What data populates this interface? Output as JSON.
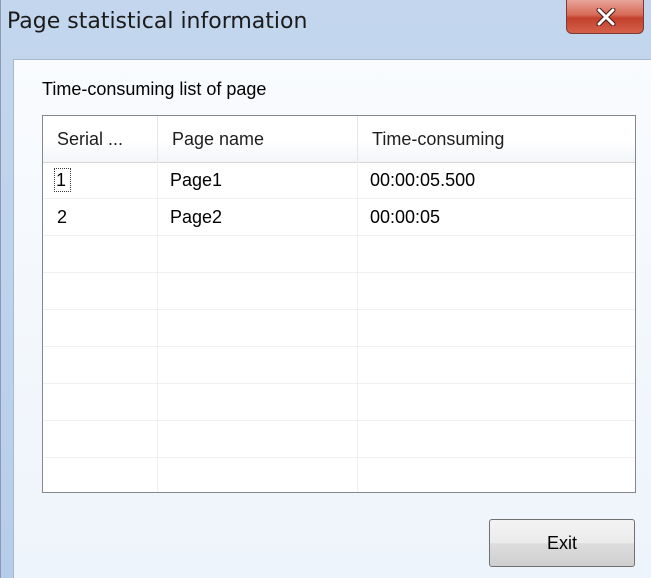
{
  "window": {
    "title": "Page statistical information"
  },
  "list": {
    "label": "Time-consuming list of page",
    "columns": [
      "Serial ...",
      "Page name",
      "Time-consuming"
    ],
    "rows": [
      [
        "1",
        "Page1",
        "00:00:05.500"
      ],
      [
        "2",
        "Page2",
        "00:00:05"
      ]
    ]
  },
  "buttons": {
    "exit_label": "Exit"
  },
  "icons": {
    "close": "close-icon"
  },
  "colors": {
    "close_button": "#c3402c",
    "window_frame": "#bcd2ec"
  }
}
